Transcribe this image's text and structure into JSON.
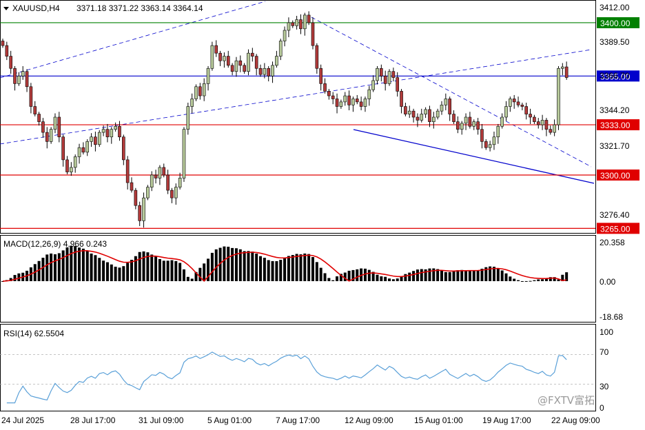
{
  "header": {
    "symbol": "XAUUSD,H4",
    "ohlc": "3371.18 3371.22 3363.14 3364.14",
    "dropdown_icon": "triangle-down-icon"
  },
  "price_axis": {
    "ticks": [
      "3412.00",
      "3389.50",
      "3366.70",
      "3344.20",
      "3321.70",
      "3276.40"
    ]
  },
  "levels": [
    {
      "label": "3400.00",
      "value": 3400.0,
      "color": "#008000"
    },
    {
      "label": "3365.00",
      "value": 3365.0,
      "color": "#0000cc"
    },
    {
      "label": "3333.00",
      "value": 3333.0,
      "color": "#e00000"
    },
    {
      "label": "3300.00",
      "value": 3300.0,
      "color": "#e00000"
    },
    {
      "label": "3265.00",
      "value": 3265.0,
      "color": "#e00000"
    }
  ],
  "macd": {
    "label": "MACD(12,26,9) 4.966 0.243",
    "ticks": [
      "20.358",
      "0.00",
      "-18.68"
    ]
  },
  "rsi": {
    "label": "RSI(14) 62.5504",
    "ticks": [
      "100",
      "70",
      "30",
      "0"
    ]
  },
  "time_axis": [
    "24 Jul 2025",
    "28 Jul 17:00",
    "31 Jul 09:00",
    "5 Aug 01:00",
    "7 Aug 17:00",
    "12 Aug 09:00",
    "15 Aug 01:00",
    "19 Aug 17:00",
    "22 Aug 09:00"
  ],
  "watermark": "@FXTV富拓",
  "colors": {
    "bull": "#b7c99a",
    "bear": "#b13a3a",
    "wick": "#000000",
    "signal": "#e00000",
    "rsi": "#5aa0d8"
  },
  "chart_data": {
    "type": "candlestick",
    "symbol": "XAUUSD",
    "timeframe": "H4",
    "ylim": [
      3262,
      3414
    ],
    "closes": [
      3385,
      3378,
      3370,
      3360,
      3365,
      3368,
      3358,
      3345,
      3340,
      3335,
      3328,
      3322,
      3330,
      3338,
      3325,
      3310,
      3302,
      3305,
      3312,
      3318,
      3315,
      3322,
      3325,
      3320,
      3328,
      3330,
      3325,
      3330,
      3332,
      3325,
      3310,
      3295,
      3290,
      3280,
      3270,
      3285,
      3292,
      3300,
      3298,
      3305,
      3300,
      3290,
      3285,
      3292,
      3298,
      3330,
      3345,
      3350,
      3358,
      3352,
      3360,
      3370,
      3385,
      3380,
      3375,
      3378,
      3372,
      3368,
      3375,
      3372,
      3368,
      3380,
      3378,
      3370,
      3366,
      3370,
      3365,
      3372,
      3378,
      3388,
      3395,
      3400,
      3398,
      3402,
      3396,
      3405,
      3400,
      3385,
      3370,
      3360,
      3355,
      3352,
      3350,
      3345,
      3348,
      3352,
      3346,
      3350,
      3348,
      3345,
      3350,
      3356,
      3362,
      3370,
      3365,
      3360,
      3368,
      3364,
      3355,
      3345,
      3340,
      3342,
      3338,
      3336,
      3340,
      3343,
      3335,
      3338,
      3342,
      3346,
      3350,
      3340,
      3335,
      3330,
      3334,
      3338,
      3332,
      3335,
      3330,
      3322,
      3318,
      3320,
      3325,
      3332,
      3338,
      3345,
      3350,
      3348,
      3346,
      3345,
      3340,
      3338,
      3335,
      3333,
      3336,
      3330,
      3328,
      3333,
      3370,
      3371,
      3364
    ],
    "macd": {
      "histogram_range": [
        -18.68,
        20.358
      ],
      "last_macd": 4.966,
      "last_signal": 0.243
    },
    "rsi": {
      "period": 14,
      "last": 62.5504,
      "levels": [
        30,
        70
      ]
    }
  }
}
